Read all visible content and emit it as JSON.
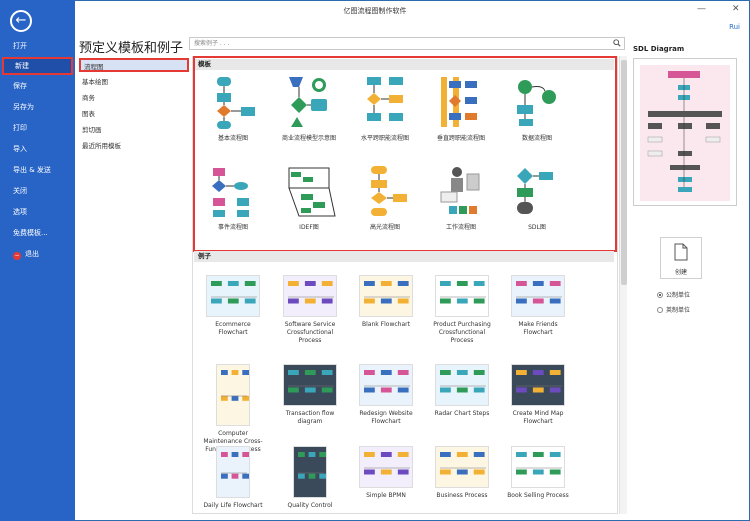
{
  "window": {
    "title": "亿图流程图制作软件",
    "user": "Rui",
    "minimize": "—",
    "close": "✕"
  },
  "sidebar": {
    "back_icon": "arrow-left-icon",
    "items": [
      "打开",
      "新建",
      "保存",
      "另存为",
      "打印",
      "导入",
      "导出 & 发送",
      "关闭",
      "选项",
      "免费模板...",
      "退出"
    ],
    "exit_symbol": "−"
  },
  "main": {
    "heading": "预定义模板和例子",
    "search_placeholder": "搜索例子 . . ."
  },
  "categories": [
    "流程图",
    "基本绘图",
    "商务",
    "图表",
    "剪切画",
    "最近所用模板"
  ],
  "templates": {
    "header": "模板",
    "items": [
      "基本流程图",
      "商业流程模型示意图",
      "水平跨职能流程图",
      "垂直跨职能流程图",
      "数据流程图",
      "事件流程图",
      "IDEF图",
      "高光流程图",
      "工作流程图",
      "SDL图"
    ]
  },
  "examples": {
    "header": "例子",
    "items": [
      [
        "Ecommerce",
        "Flowchart"
      ],
      [
        "Software Service",
        "Crossfunctional",
        "Process"
      ],
      [
        "Blank Flowchart"
      ],
      [
        "Product Purchasing",
        "Crossfunctional",
        "Process"
      ],
      [
        "Make Friends",
        "Flowchart"
      ],
      [
        "Computer",
        "Maintenance Cross-",
        "Functional Process"
      ],
      [
        "Transaction flow",
        "diagram"
      ],
      [
        "Redesign Website",
        "Flowchart"
      ],
      [
        "Radar Chart Steps"
      ],
      [
        "Create Mind Map",
        "Flowchart"
      ],
      [
        "Daily Life Flowchart"
      ],
      [
        "Quality Control"
      ],
      [
        "Simple BPMN"
      ],
      [
        "Business Process"
      ],
      [
        "Book Selling Process"
      ]
    ]
  },
  "right": {
    "title": "SDL Diagram",
    "create_label": "创建",
    "unit_metric": "公制单位",
    "unit_imperial": "英制单位"
  }
}
